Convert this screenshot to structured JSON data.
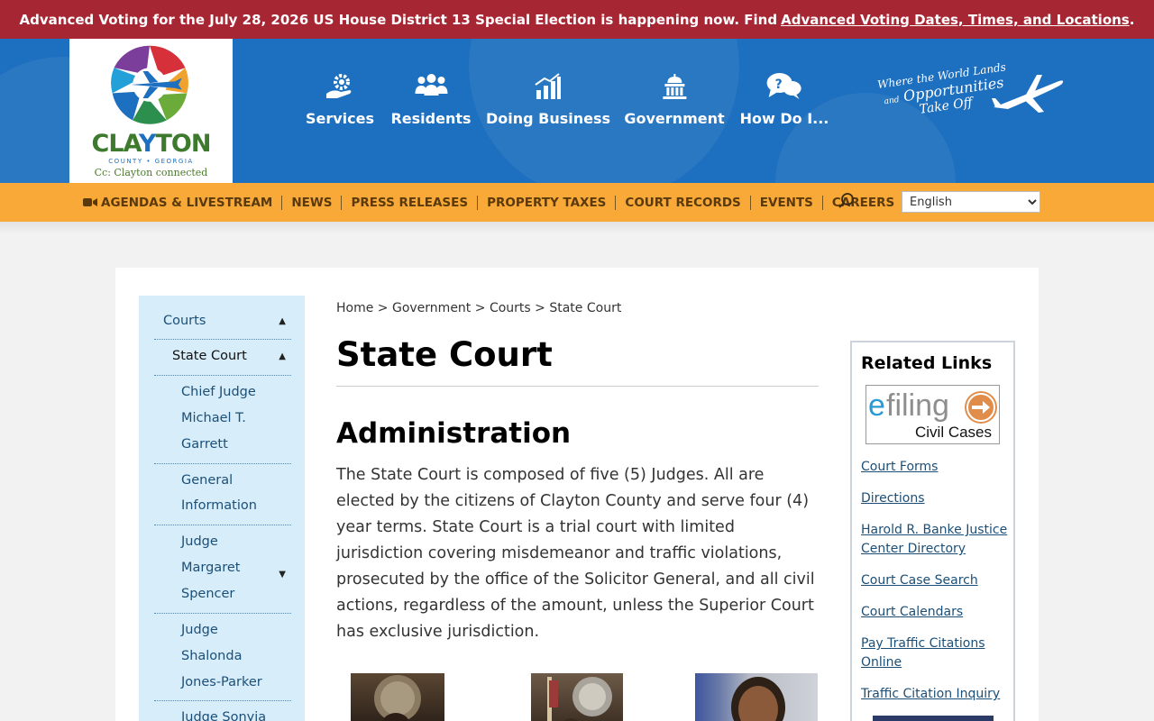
{
  "alert": {
    "text": "Advanced Voting for the July 28, 2026 US House District 13 Special Election is happening now. Find",
    "link": "Advanced Voting Dates, Times, and Locations",
    "end": "."
  },
  "logo": {
    "word_c": "C",
    "word_l": "LA",
    "word_y": "Y",
    "word_rest": "TON",
    "sub": "COUNTY • GEORGIA",
    "tag": "Cc: Clayton connected"
  },
  "nav": [
    {
      "label": "Services",
      "icon": "services-icon"
    },
    {
      "label": "Residents",
      "icon": "residents-icon"
    },
    {
      "label": "Doing Business",
      "icon": "chart-icon"
    },
    {
      "label": "Government",
      "icon": "capitol-icon"
    },
    {
      "label": "How Do I...",
      "icon": "question-bubbles-icon"
    }
  ],
  "tagline": {
    "line1": "Where the World Lands",
    "line2_small": "and",
    "line2": "Opportunities",
    "line3": "Take Off"
  },
  "subnav": [
    "AGENDAS & LIVESTREAM",
    "NEWS",
    "PRESS RELEASES",
    "PROPERTY TAXES",
    "COURT RECORDS",
    "EVENTS",
    "CAREERS"
  ],
  "language": {
    "selected": "English"
  },
  "sidebar": {
    "courts": "Courts",
    "state_court": "State Court",
    "chief_judge": [
      "Chief Judge",
      "Michael T.",
      "Garrett"
    ],
    "general_info": [
      "General",
      "Information"
    ],
    "judge_spencer": [
      "Judge",
      "Margaret",
      "Spencer"
    ],
    "judge_jones": [
      "Judge",
      "Shalonda",
      "Jones-Parker"
    ],
    "judge_sonyia": "Judge Sonyia"
  },
  "breadcrumb": {
    "home": "Home",
    "government": "Government",
    "courts": "Courts",
    "current": "State Court",
    "sep": ">"
  },
  "page": {
    "title": "State Court",
    "section": "Administration",
    "body": "The State Court is composed of five (5) Judges. All are elected by the citizens of Clayton County and serve four (4) year terms. State Court is a trial court with limited jurisdiction covering misdemeanor and traffic violations, prosecuted by the office of the Solicitor General, and all civil actions, regardless of the amount, unless the Superior Court has exclusive jurisdiction."
  },
  "related": {
    "heading": "Related Links",
    "efile_e": "e",
    "efile_filing": "filing",
    "efile_sub": "Civil Cases",
    "links": [
      "Court Forms",
      "Directions",
      "Harold R. Banke Justice Center Directory",
      "Court Case Search",
      "Court Calendars",
      "Pay Traffic Citations Online",
      "Traffic Citation Inquiry"
    ]
  },
  "colors": {
    "alert": "#a62733",
    "header": "#1d6fbf",
    "subnav": "#f8a937",
    "sidebar": "#d7edfa",
    "link": "#1c4f77"
  }
}
